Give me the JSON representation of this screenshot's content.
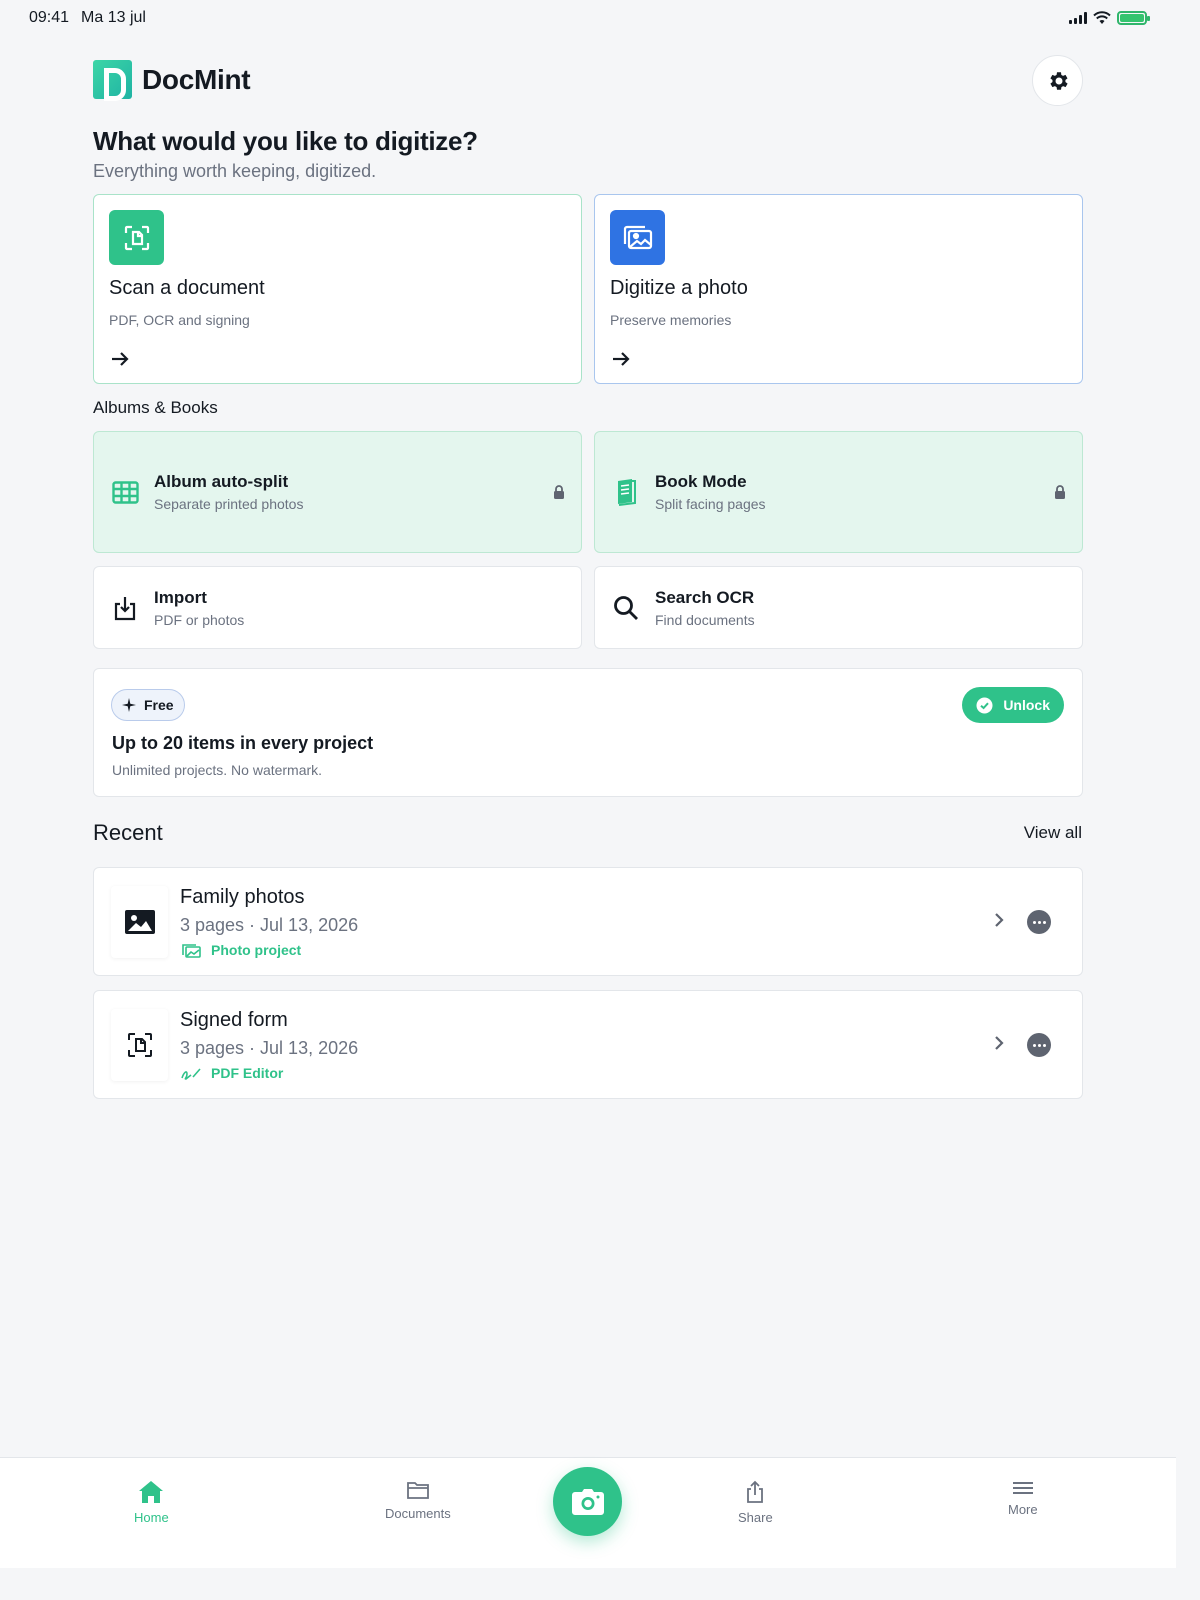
{
  "status_bar": {
    "time": "09:41",
    "date": "Ma 13 jul",
    "battery_color": "#34c46f"
  },
  "header": {
    "brand": "DocMint",
    "settings_icon": "gear-icon"
  },
  "hero": {
    "title": "What would you like to digitize?",
    "subtitle": "Everything worth keeping, digitized."
  },
  "primary_actions": [
    {
      "title": "Scan a document",
      "subtitle": "PDF, OCR and signing",
      "icon": "scan-document-icon",
      "color": "#2fc28a"
    },
    {
      "title": "Digitize a photo",
      "subtitle": "Preserve memories",
      "icon": "photos-icon",
      "color": "#2f73e3"
    }
  ],
  "albums_section": {
    "label": "Albums & Books",
    "items": [
      {
        "title": "Album auto-split",
        "subtitle": "Separate printed photos",
        "icon": "grid-icon",
        "locked": true
      },
      {
        "title": "Book Mode",
        "subtitle": "Split facing pages",
        "icon": "book-icon",
        "locked": true
      },
      {
        "title": "Import",
        "subtitle": "PDF or photos",
        "icon": "import-icon",
        "locked": false
      },
      {
        "title": "Search OCR",
        "subtitle": "Find documents",
        "icon": "search-icon",
        "locked": false
      }
    ]
  },
  "promo": {
    "badge": "Free",
    "unlock": "Unlock",
    "title": "Up to 20 items in every project",
    "subtitle": "Unlimited projects. No watermark."
  },
  "recent": {
    "title": "Recent",
    "view_all": "View all",
    "items": [
      {
        "title": "Family photos",
        "meta": "3 pages · Jul 13, 2026",
        "tag": "Photo project",
        "icon": "image-icon"
      },
      {
        "title": "Signed form",
        "meta": "3 pages · Jul 13, 2026",
        "tag": "PDF Editor",
        "icon": "scan-document-icon"
      }
    ]
  },
  "tabbar": {
    "home": "Home",
    "documents": "Documents",
    "share": "Share",
    "more": "More",
    "accent": "#2fc28a"
  }
}
